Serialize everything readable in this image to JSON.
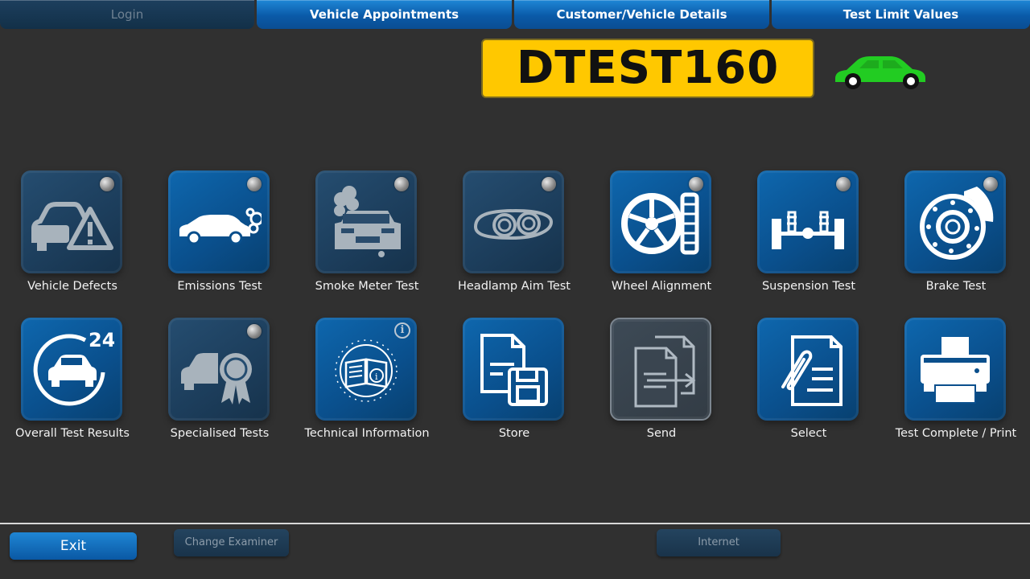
{
  "tabs": [
    {
      "label": "Login",
      "enabled": false
    },
    {
      "label": "Vehicle Appointments",
      "enabled": true
    },
    {
      "label": "Customer/Vehicle Details",
      "enabled": true
    },
    {
      "label": "Test Limit Values",
      "enabled": true
    }
  ],
  "plate": {
    "registration": "DTEST160"
  },
  "vehicle_status_color": "#22cc22",
  "tiles_row1": [
    {
      "label": "Vehicle Defects",
      "icon": "car-warning-icon"
    },
    {
      "label": "Emissions Test",
      "icon": "exhaust-car-icon"
    },
    {
      "label": "Smoke Meter Test",
      "icon": "smoke-car-icon"
    },
    {
      "label": "Headlamp Aim Test",
      "icon": "headlamp-icon"
    },
    {
      "label": "Wheel Alignment",
      "icon": "wheel-icon"
    },
    {
      "label": "Suspension Test",
      "icon": "axle-icon"
    },
    {
      "label": "Brake Test",
      "icon": "brake-disc-icon"
    }
  ],
  "tiles_row2": [
    {
      "label": "Overall Test Results",
      "icon": "car-24-icon"
    },
    {
      "label": "Specialised Tests",
      "icon": "car-award-icon"
    },
    {
      "label": "Technical Information",
      "icon": "manual-book-icon"
    },
    {
      "label": "Store",
      "icon": "document-save-icon"
    },
    {
      "label": "Send",
      "icon": "document-send-icon"
    },
    {
      "label": "Select",
      "icon": "document-clip-icon"
    },
    {
      "label": "Test Complete / Print",
      "icon": "printer-icon"
    }
  ],
  "footer": {
    "exit_label": "Exit",
    "change_examiner_label": "Change Examiner",
    "internet_label": "Internet"
  },
  "colors": {
    "accent": "#0a5aa8",
    "plate": "#ffc800",
    "background": "#303030"
  }
}
